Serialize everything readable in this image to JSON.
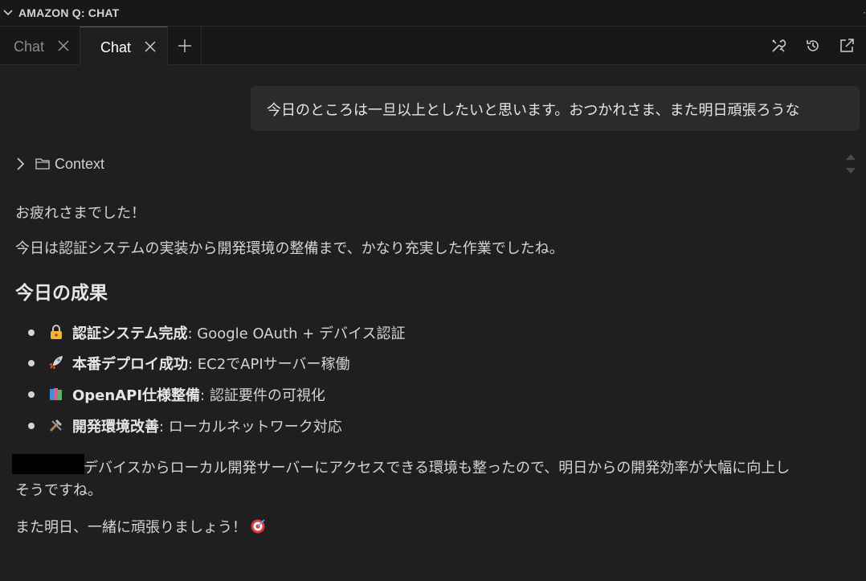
{
  "panel": {
    "title": "AMAZON Q: CHAT"
  },
  "tabs": [
    {
      "label": "Chat",
      "active": false
    },
    {
      "label": "Chat",
      "active": true
    }
  ],
  "user_message": "今日のところは一旦以上としたいと思います。おつかれさま、また明日頑張ろうな",
  "context": {
    "label": "Context"
  },
  "response": {
    "greeting": "お疲れさまでした！",
    "summary": "今日は認証システムの実装から開発環境の整備まで、かなり充実した作業でしたね。",
    "heading": "今日の成果",
    "achievements": [
      {
        "icon": "lock-key-icon",
        "title": "認証システム完成",
        "detail": ": Google OAuth + デバイス認証"
      },
      {
        "icon": "rocket-icon",
        "title": "本番デプロイ成功",
        "detail": ": EC2でAPIサーバー稼働"
      },
      {
        "icon": "books-icon",
        "title": "OpenAPI仕様整備",
        "detail": ": 認証要件の可視化"
      },
      {
        "icon": "tools-icon",
        "title": "開発環境改善",
        "detail": ": ローカルネットワーク対応"
      }
    ],
    "paragraph_line1": "デバイスからローカル開発サーバーにアクセスできる環境も整ったので、明日からの開発効率が大幅に向上し",
    "paragraph_line2": "そうですね。",
    "closing": "また明日、一緒に頑張りましょう！"
  },
  "colors": {
    "background": "#1f1f1f",
    "tabbar": "#181818",
    "accent": "#0078d4",
    "user_bubble": "#2b2b2b"
  }
}
